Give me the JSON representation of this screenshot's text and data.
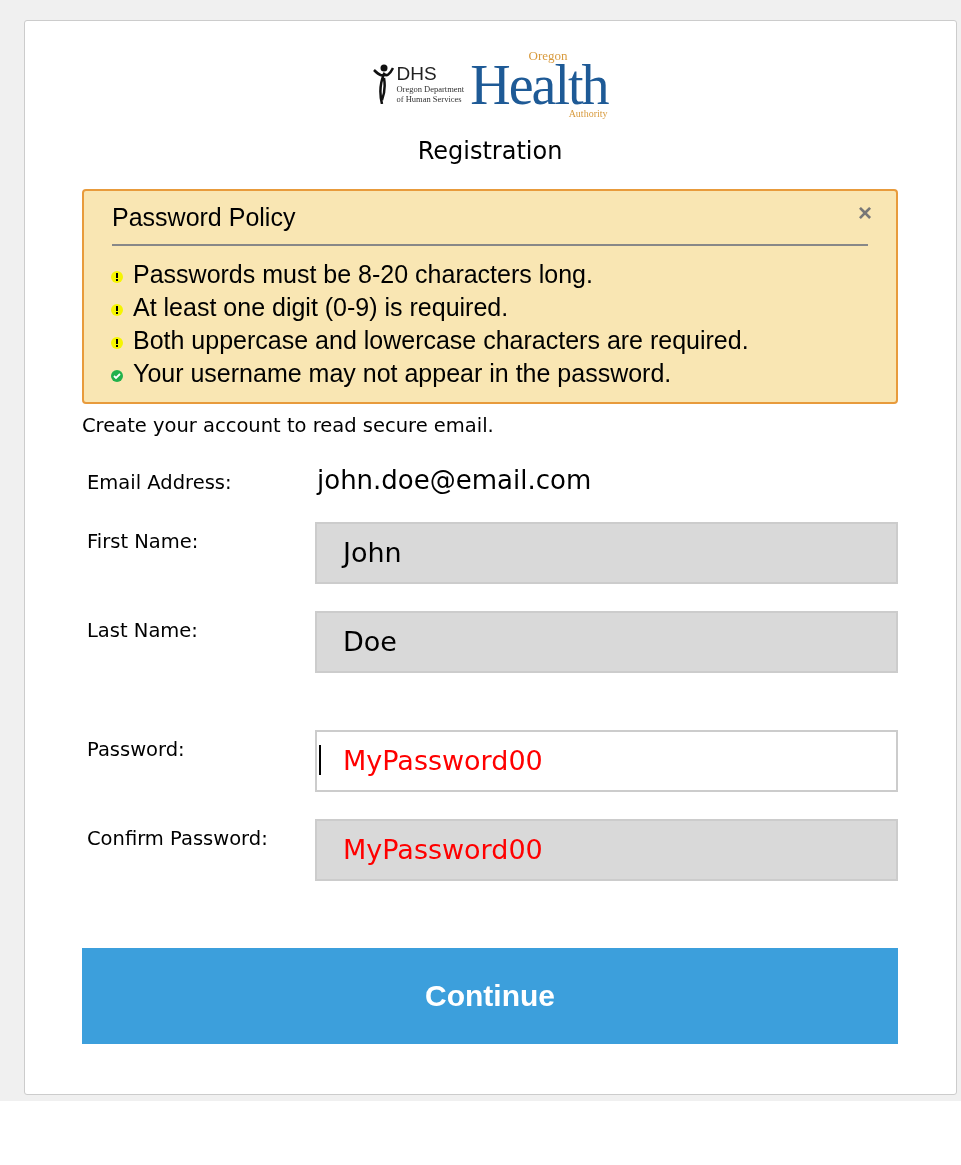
{
  "logo": {
    "dhs": "DHS",
    "dhs_sub": [
      "Oregon Department",
      "of Human Services"
    ],
    "oha_top": "Oregon",
    "oha_main": "Health",
    "oha_bottom": "Authority"
  },
  "title": "Registration",
  "policy": {
    "title": "Password Policy",
    "close": "×",
    "rules": [
      {
        "text": "Passwords must be 8-20 characters long.",
        "met": false
      },
      {
        "text": "At least one digit (0-9) is required.",
        "met": false
      },
      {
        "text": "Both uppercase and lowercase characters are required.",
        "met": false
      },
      {
        "text": "Your username may not appear in the password.",
        "met": true
      }
    ]
  },
  "intro": "Create your account to read secure email.",
  "fields": [
    {
      "label": "Email Address:",
      "kind": "static",
      "value": "john.doe@email.com"
    },
    {
      "label": "First Name:",
      "kind": "input",
      "value": "John",
      "disabled": true,
      "focused": false,
      "invalid": false
    },
    {
      "label": "Last Name:",
      "kind": "input",
      "value": "Doe",
      "disabled": true,
      "focused": false,
      "invalid": false
    },
    {
      "label": "Password:",
      "kind": "input",
      "value": "MyPassword00",
      "disabled": false,
      "focused": true,
      "invalid": true
    },
    {
      "label": "Confirm Password:",
      "kind": "input",
      "value": "MyPassword00",
      "disabled": true,
      "focused": false,
      "invalid": true
    }
  ],
  "button": "Continue"
}
